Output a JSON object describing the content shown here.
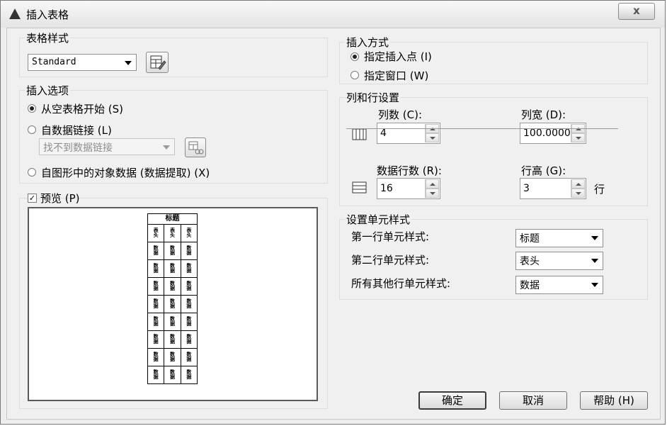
{
  "window": {
    "title": "插入表格",
    "close_glyph": "x"
  },
  "table_style": {
    "group_label": "表格样式",
    "selected": "Standard",
    "launch_icon": "table-style-dialog-icon"
  },
  "insert_options": {
    "group_label": "插入选项",
    "from_empty": "从空表格开始 (S)",
    "from_data_link": "自数据链接 (L)",
    "data_link_value": "找不到数据链接",
    "data_link_icon": "data-link-manager-icon",
    "from_object_data": "自图形中的对象数据 (数据提取) (X)",
    "selected": "from_empty"
  },
  "preview": {
    "label": "预览 (P)",
    "checked": true,
    "title_cell": "标题",
    "header_cells": [
      "表\n头",
      "表\n头",
      "表\n头"
    ],
    "data_cell": "数\n据",
    "data_row_count": 8
  },
  "insertion_behavior": {
    "group_label": "插入方式",
    "specify_point": "指定插入点 (I)",
    "specify_window": "指定窗口 (W)",
    "selected": "specify_point"
  },
  "column_row": {
    "group_label": "列和行设置",
    "columns_label": "列数 (C):",
    "columns_value": "4",
    "column_width_label": "列宽 (D):",
    "column_width_value": "100.0000",
    "data_rows_label": "数据行数 (R):",
    "data_rows_value": "16",
    "row_height_label": "行高 (G):",
    "row_height_value": "3",
    "row_unit": "行",
    "columns_icon": "columns-icon",
    "rows_icon": "rows-icon"
  },
  "cell_styles": {
    "group_label": "设置单元样式",
    "first_row_label": "第一行单元样式:",
    "first_row_value": "标题",
    "second_row_label": "第二行单元样式:",
    "second_row_value": "表头",
    "other_rows_label": "所有其他行单元样式:",
    "other_rows_value": "数据"
  },
  "buttons": {
    "ok": "确定",
    "cancel": "取消",
    "help": "帮助 (H)"
  }
}
